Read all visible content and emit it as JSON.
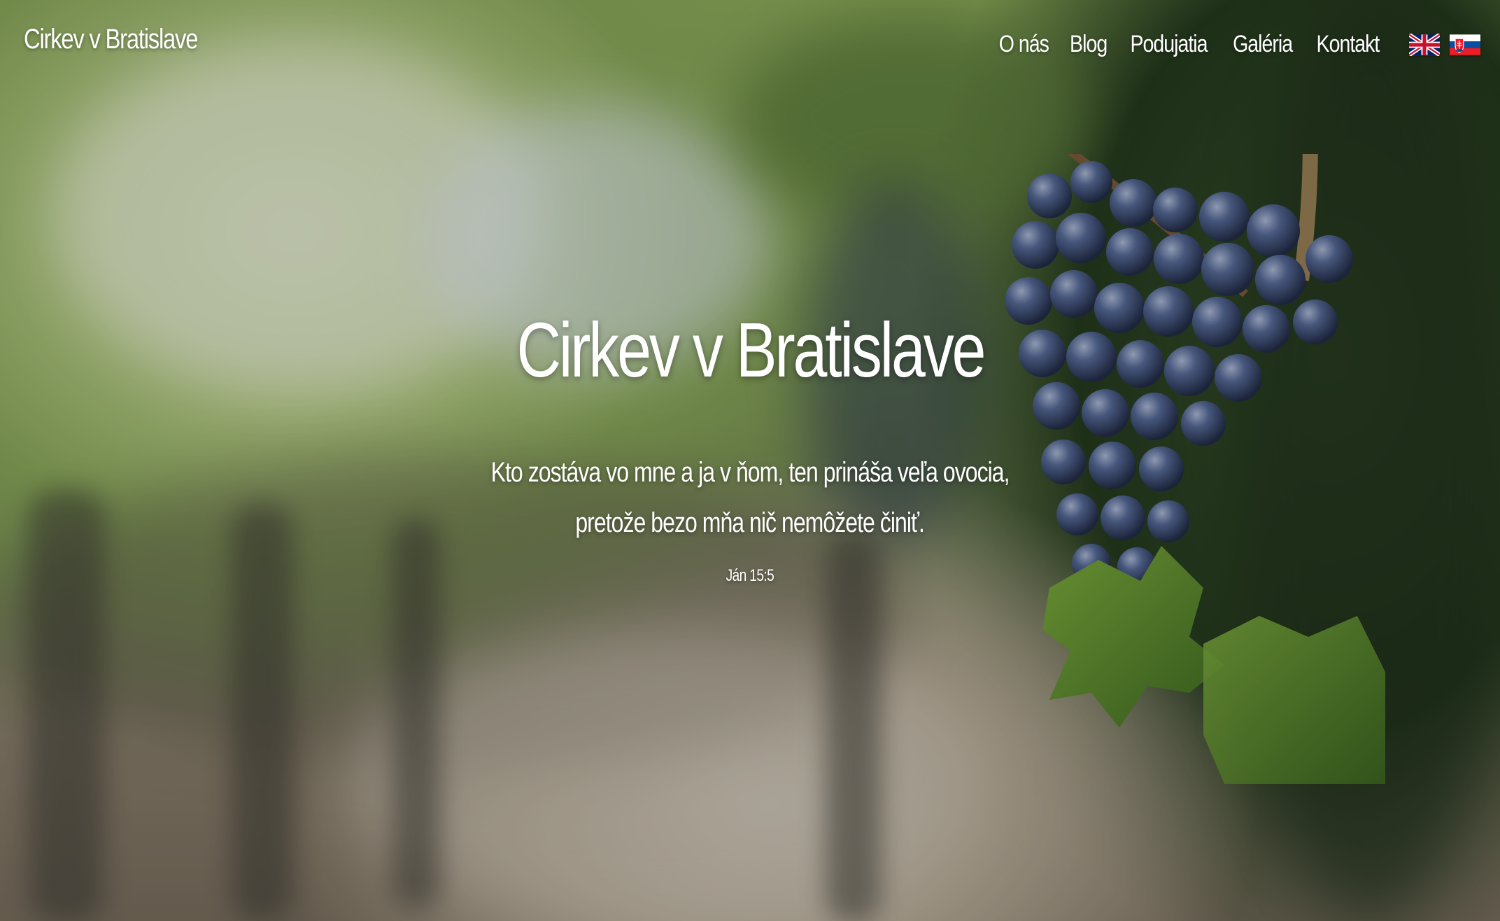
{
  "site": {
    "brand": "Cirkev v Bratislave"
  },
  "nav": {
    "items": [
      {
        "label": "O nás"
      },
      {
        "label": "Blog"
      },
      {
        "label": "Podujatia"
      },
      {
        "label": "Galéria"
      },
      {
        "label": "Kontakt"
      }
    ],
    "languages": [
      {
        "icon": "uk-flag-icon"
      },
      {
        "icon": "slovak-flag-icon"
      }
    ]
  },
  "hero": {
    "title": "Cirkev v Bratislave",
    "verse_line1": "Kto zostáva vo mne a ja v ňom, ten prináša veľa ovocia,",
    "verse_line2": "pretože bezo mňa nič nemôžete činiť.",
    "reference": "Ján 15:5",
    "background_image": "vineyard-grapes-photo"
  },
  "colors": {
    "text": "#ffffff",
    "foliage": "#8fae5c",
    "grape": "#3d4f7c"
  }
}
